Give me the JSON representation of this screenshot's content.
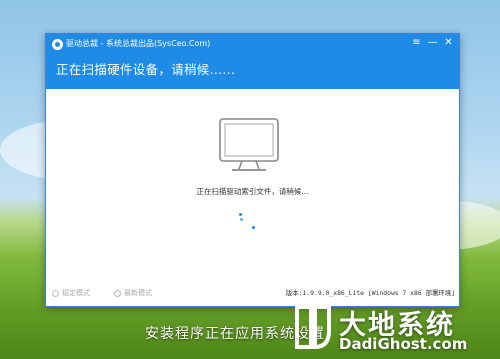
{
  "window": {
    "title": "驱动总裁 - 系统总裁出品(SysCeo.Com)",
    "heading": "正在扫描硬件设备，请稍候......",
    "controls": {
      "menu_glyph": "≡",
      "minimize_glyph": "—",
      "close_glyph": "✕"
    }
  },
  "scan": {
    "status_text": "正在扫描驱动索引文件，请稍候..."
  },
  "footer": {
    "mode_options": [
      "稳定模式",
      "最新模式"
    ],
    "version_text": "版本:1.9.9.0_x86_Lite [Windows 7 x86 部署环境]"
  },
  "desktop": {
    "status_caption": "安装程序正在应用系统设置"
  },
  "watermark": {
    "cn": "大地系统",
    "en": "DadiGhost.com"
  },
  "colors": {
    "accent": "#1e8be6",
    "window_bg": "#ffffff"
  },
  "icons": {
    "app": "app-logo-icon",
    "monitor": "monitor-icon",
    "spinner": "loading-spinner-icon"
  }
}
